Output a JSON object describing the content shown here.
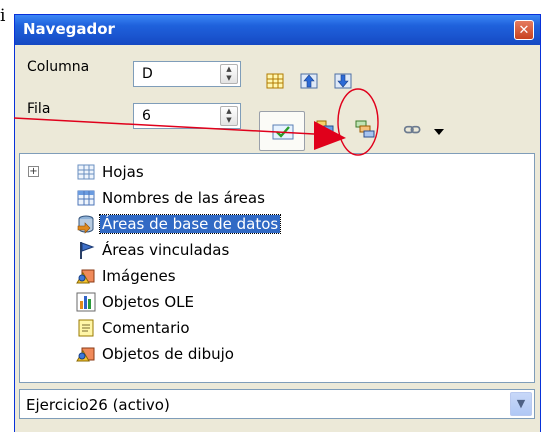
{
  "edge_text": "i",
  "window": {
    "title": "Navegador",
    "close_glyph": "✕"
  },
  "fields": {
    "column_label": "Columna",
    "column_value": "D",
    "row_label": "Fila",
    "row_value": "6"
  },
  "toolbar": {
    "icons": [
      "data-range-icon",
      "start-icon",
      "end-icon",
      "content-toggle-icon",
      "scenarios-icon",
      "drag-mode-icon",
      "link-icon"
    ]
  },
  "tree": {
    "items": [
      {
        "label": "Hojas",
        "icon": "sheets-icon",
        "expandable": true,
        "selected": false
      },
      {
        "label": "Nombres de las áreas",
        "icon": "range-names-icon",
        "expandable": false,
        "selected": false
      },
      {
        "label": "Áreas de base de datos",
        "icon": "database-ranges-icon",
        "expandable": false,
        "selected": true
      },
      {
        "label": "Áreas vinculadas",
        "icon": "linked-areas-icon",
        "expandable": false,
        "selected": false
      },
      {
        "label": "Imágenes",
        "icon": "images-icon",
        "expandable": false,
        "selected": false
      },
      {
        "label": "Objetos OLE",
        "icon": "ole-objects-icon",
        "expandable": false,
        "selected": false
      },
      {
        "label": "Comentario",
        "icon": "comment-icon",
        "expandable": false,
        "selected": false
      },
      {
        "label": "Objetos de dibujo",
        "icon": "drawing-objects-icon",
        "expandable": false,
        "selected": false
      }
    ],
    "expander_glyph": "+"
  },
  "document_select": {
    "value": "Ejercicio26 (activo)"
  },
  "annotation_color": "#e0001b"
}
